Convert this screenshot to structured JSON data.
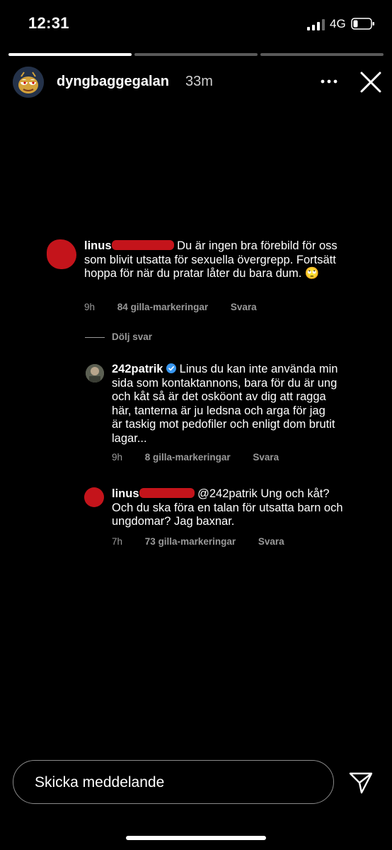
{
  "status": {
    "time": "12:31",
    "network": "4G"
  },
  "story": {
    "username": "dyngbaggegalan",
    "elapsed": "33m",
    "progress": [
      1.0,
      0.0,
      0.0
    ]
  },
  "comments": [
    {
      "name": "linus",
      "text": "Du är ingen bra förebild för oss som blivit utsatta för sexuella övergrepp. Fortsätt hoppa för när du pratar låter du bara dum. 🙄",
      "time": "9h",
      "likes": "84 gilla-markeringar",
      "reply": "Svara"
    },
    {
      "name": "242patrik",
      "text": "Linus du kan inte använda min sida som kontaktannons, bara för du är ung och kåt så är det osköont av dig att ragga här, tanterna är ju ledsna och arga för jag är taskig mot pedofiler och enligt dom brutit lagar...",
      "time": "9h",
      "likes": "8 gilla-markeringar",
      "reply": "Svara"
    },
    {
      "name": "linus",
      "text": "@242patrik Ung och kåt? Och du ska föra en talan för utsatta barn och ungdomar? Jag baxnar.",
      "time": "7h",
      "likes": "73 gilla-markeringar",
      "reply": "Svara"
    }
  ],
  "hide_replies": "Dölj svar",
  "message_input": {
    "placeholder": "Skicka meddelande"
  },
  "colors": {
    "redaction": "#c4141b",
    "verified": "#3897f0",
    "background": "#000000"
  },
  "icons": [
    "more-options-icon",
    "close-icon",
    "send-icon",
    "verified-badge-icon",
    "rolling-eyes-emoji"
  ]
}
